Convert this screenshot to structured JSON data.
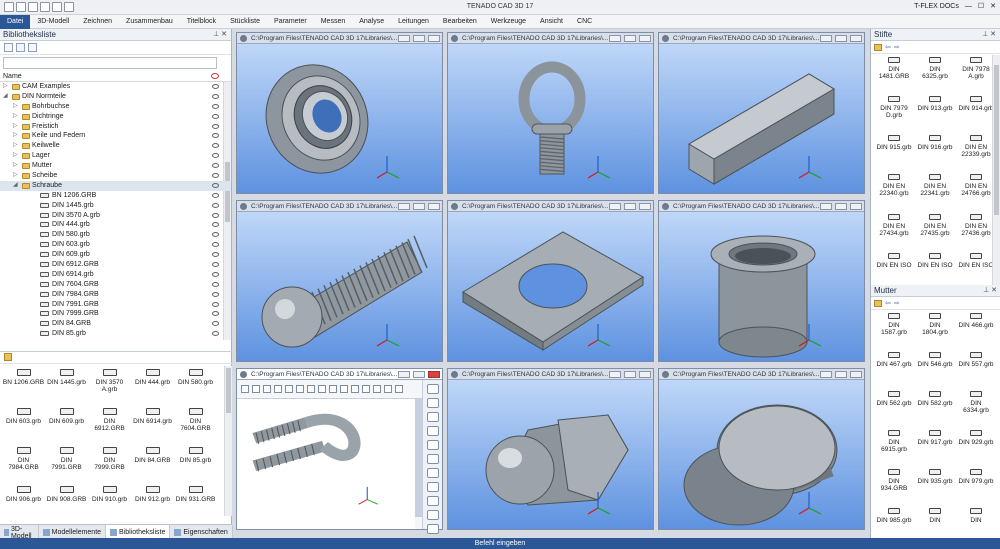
{
  "titlebar": {
    "title": "TENADO CAD 3D 17",
    "user": "T-FLEX DOCs"
  },
  "menu": [
    "Datei",
    "3D-Modell",
    "Zeichnen",
    "Zusammenbau",
    "Titelblock",
    "Stückliste",
    "Parameter",
    "Messen",
    "Analyse",
    "Leitungen",
    "Bearbeiten",
    "Werkzeuge",
    "Ansicht",
    "CNC"
  ],
  "left": {
    "title": "Bibliotheksliste",
    "column": "Name",
    "tree": [
      {
        "label": "CAM Examples",
        "level": 0,
        "type": "folder",
        "exp": "▷"
      },
      {
        "label": "DIN Normteile",
        "level": 0,
        "type": "folder",
        "exp": "◢"
      },
      {
        "label": "Bohrbuchse",
        "level": 1,
        "type": "folder",
        "exp": "▷"
      },
      {
        "label": "Dichtringe",
        "level": 1,
        "type": "folder",
        "exp": "▷"
      },
      {
        "label": "Freistich",
        "level": 1,
        "type": "folder",
        "exp": "▷"
      },
      {
        "label": "Keile und Federn",
        "level": 1,
        "type": "folder",
        "exp": "▷"
      },
      {
        "label": "Keilwelle",
        "level": 1,
        "type": "folder",
        "exp": "▷"
      },
      {
        "label": "Lager",
        "level": 1,
        "type": "folder",
        "exp": "▷"
      },
      {
        "label": "Mutter",
        "level": 1,
        "type": "folder",
        "exp": "▷"
      },
      {
        "label": "Scheibe",
        "level": 1,
        "type": "folder",
        "exp": "▷"
      },
      {
        "label": "Schraube",
        "level": 1,
        "type": "folder",
        "exp": "◢",
        "sel": true
      },
      {
        "label": "BN 1206.GRB",
        "level": 2,
        "type": "doc"
      },
      {
        "label": "DIN 1445.grb",
        "level": 2,
        "type": "doc"
      },
      {
        "label": "DIN 3570 A.grb",
        "level": 2,
        "type": "doc"
      },
      {
        "label": "DIN 444.grb",
        "level": 2,
        "type": "doc"
      },
      {
        "label": "DIN 580.grb",
        "level": 2,
        "type": "doc"
      },
      {
        "label": "DIN 603.grb",
        "level": 2,
        "type": "doc"
      },
      {
        "label": "DIN 609.grb",
        "level": 2,
        "type": "doc"
      },
      {
        "label": "DIN 6912.GRB",
        "level": 2,
        "type": "doc"
      },
      {
        "label": "DIN 6914.grb",
        "level": 2,
        "type": "doc"
      },
      {
        "label": "DIN 7604.GRB",
        "level": 2,
        "type": "doc"
      },
      {
        "label": "DIN 7984.GRB",
        "level": 2,
        "type": "doc"
      },
      {
        "label": "DIN 7991.GRB",
        "level": 2,
        "type": "doc"
      },
      {
        "label": "DIN 7999.GRB",
        "level": 2,
        "type": "doc"
      },
      {
        "label": "DIN 84.GRB",
        "level": 2,
        "type": "doc"
      },
      {
        "label": "DIN 85.grb",
        "level": 2,
        "type": "doc"
      },
      {
        "label": "DIN 906.grb",
        "level": 2,
        "type": "doc"
      }
    ],
    "grid": [
      "BN 1206.GRB",
      "DIN 1445.grb",
      "DIN 3570 A.grb",
      "DIN 444.grb",
      "DIN 580.grb",
      "DIN 603.grb",
      "DIN 609.grb",
      "DIN 6912.GRB",
      "DIN 6914.grb",
      "DIN 7604.GRB",
      "DIN 7984.GRB",
      "DIN 7991.GRB",
      "DIN 7999.GRB",
      "DIN 84.GRB",
      "DIN 85.grb",
      "DIN 906.grb",
      "DIN 908.GRB",
      "DIN 910.grb",
      "DIN 912.grb",
      "DIN 931.GRB"
    ],
    "tabs": [
      "3D-Modell",
      "Modellelemente",
      "Bibliotheksliste",
      "Eigenschaften"
    ]
  },
  "viewport_title": "C:\\Program Files\\TENADO CAD 3D 17\\Libraries\\...",
  "viewport_active_title": "C:\\Program Files\\TENADO CAD 3D 17\\Libraries\\...",
  "right": {
    "stifte_title": "Stifte",
    "stifte": [
      "DIN 1481.GRB",
      "DIN 6325.grb",
      "DIN 7978 A.grb",
      "DIN 7979 D.grb",
      "DIN 913.grb",
      "DIN 914.grb",
      "DIN 915.grb",
      "DIN 916.grb",
      "DIN EN 22339.grb",
      "DIN EN 22340.grb",
      "DIN EN 22341.grb",
      "DIN EN 24766.grb",
      "DIN EN 27434.grb",
      "DIN EN 27435.grb",
      "DIN EN 27436.grb",
      "DIN EN ISO",
      "DIN EN ISO",
      "DIN EN ISO"
    ],
    "mutter_title": "Mutter",
    "mutter": [
      "DIN 1587.grb",
      "DIN 1804.grb",
      "DIN 466.grb",
      "DIN 467.grb",
      "DIN 546.grb",
      "DIN 557.grb",
      "DIN 562.grb",
      "DIN 582.grb",
      "DIN 6334.grb",
      "DIN 6915.grb",
      "DIN 917.grb",
      "DIN 929.grb",
      "DIN 934.GRB",
      "DIN 935.grb",
      "DIN 979.grb",
      "DIN 985.grb",
      "DIN",
      "DIN"
    ]
  },
  "status": "Befehl eingeben",
  "colors": {
    "accent": "#2b5797",
    "viewport_top": "#bfd7f8",
    "viewport_bottom": "#5e92e0"
  }
}
